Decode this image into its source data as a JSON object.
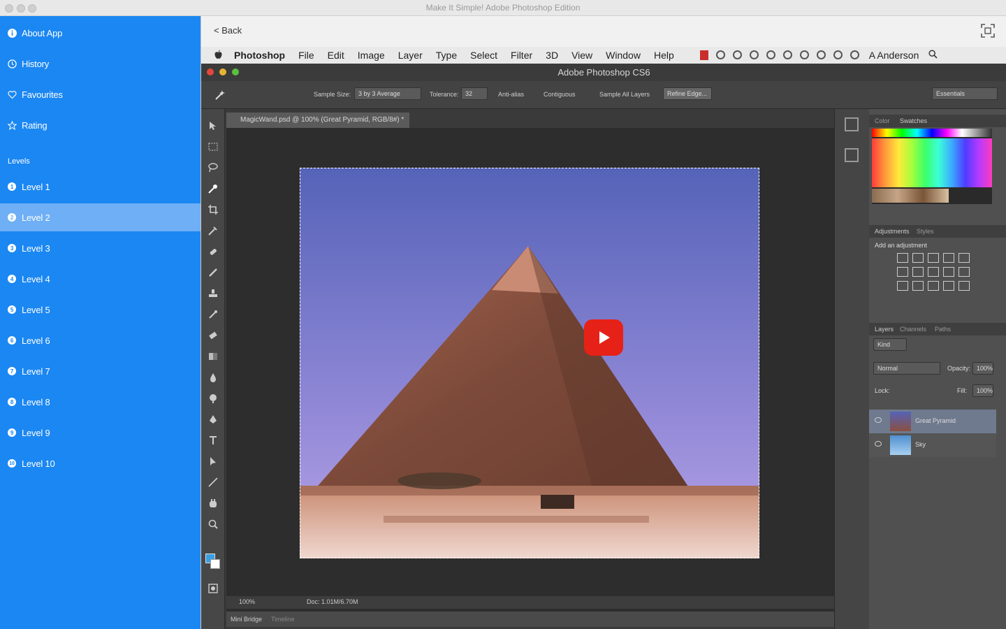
{
  "window": {
    "title": "Make It Simple! Adobe Photoshop Edition"
  },
  "sidebar": {
    "top_items": [
      {
        "label": "About App",
        "icon": "info-icon"
      },
      {
        "label": "History",
        "icon": "clock-icon"
      },
      {
        "label": "Favourites",
        "icon": "heart-icon"
      },
      {
        "label": "Rating",
        "icon": "star-icon"
      }
    ],
    "levels_heading": "Levels",
    "levels": [
      {
        "num": "1",
        "label": "Level 1"
      },
      {
        "num": "2",
        "label": "Level 2"
      },
      {
        "num": "3",
        "label": "Level 3"
      },
      {
        "num": "4",
        "label": "Level 4"
      },
      {
        "num": "5",
        "label": "Level 5"
      },
      {
        "num": "6",
        "label": "Level 6"
      },
      {
        "num": "7",
        "label": "Level 7"
      },
      {
        "num": "8",
        "label": "Level 8"
      },
      {
        "num": "9",
        "label": "Level 9"
      },
      {
        "num": "10",
        "label": "Level 10"
      }
    ],
    "selected_level": "Level 2",
    "colors": {
      "background": "#1b87f2",
      "selected": "#6eaff5"
    }
  },
  "navbar": {
    "back_label": "< Back"
  },
  "video": {
    "mac_menu": {
      "app": "Photoshop",
      "items": [
        "File",
        "Edit",
        "Image",
        "Layer",
        "Type",
        "Select",
        "Filter",
        "3D",
        "View",
        "Window",
        "Help"
      ],
      "user": "A Anderson"
    },
    "ps_title": "Adobe Photoshop CS6",
    "options": {
      "sample_size_label": "Sample Size:",
      "sample_size_value": "3 by 3 Average",
      "tolerance_label": "Tolerance:",
      "tolerance_value": "32",
      "anti_alias": "Anti-alias",
      "contiguous": "Contiguous",
      "sample_all": "Sample All Layers",
      "refine_edge": "Refine Edge...",
      "workspace": "Essentials"
    },
    "doc_tab": "MagicWand.psd @ 100% (Great Pyramid, RGB/8#) *",
    "status": {
      "zoom": "100%",
      "doc": "Doc: 1.01M/6.70M"
    },
    "bottom_tabs": [
      "Mini Bridge",
      "Timeline"
    ],
    "panels": {
      "color_tabs": [
        "Color",
        "Swatches"
      ],
      "adjust_tabs": [
        "Adjustments",
        "Styles"
      ],
      "adjust_hint": "Add an adjustment",
      "layer_tabs": [
        "Layers",
        "Channels",
        "Paths"
      ],
      "kind": "Kind",
      "blend": "Normal",
      "opacity_label": "Opacity:",
      "opacity_value": "100%",
      "lock_label": "Lock:",
      "fill_label": "Fill:",
      "fill_value": "100%",
      "layers": [
        "Great Pyramid",
        "Sky"
      ]
    }
  }
}
